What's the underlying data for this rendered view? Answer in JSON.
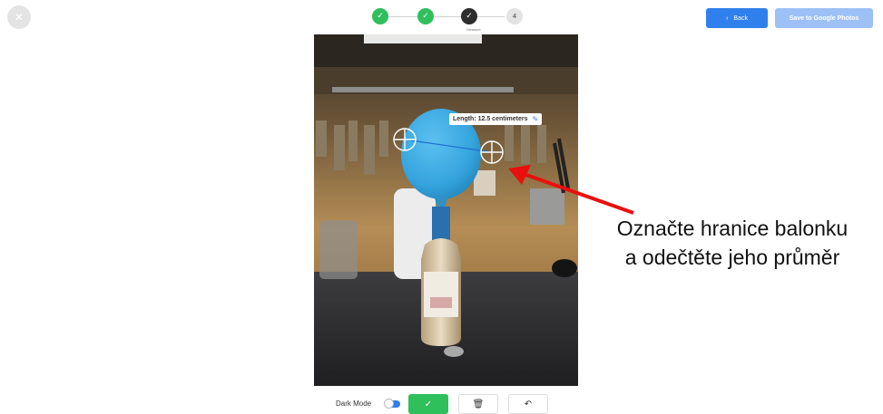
{
  "header": {
    "close_icon": "close-icon",
    "back_label": "Back",
    "back_icon": "chevron-left-icon",
    "save_label": "Save to Google Photos"
  },
  "stepper": {
    "steps": [
      {
        "state": "done",
        "glyph": "✓"
      },
      {
        "state": "done",
        "glyph": "✓"
      },
      {
        "state": "active",
        "glyph": "✓",
        "caption": "Measure"
      },
      {
        "state": "todo",
        "glyph": "4"
      }
    ]
  },
  "measurement": {
    "label": "Length: 12.5 centimeters",
    "edit_icon": "edit-icon"
  },
  "annotation": {
    "line1": "Označte hranice balonku",
    "line2": "a odečtěte jeho průměr",
    "arrow_color": "#e8100c"
  },
  "toolbar": {
    "dark_mode_label": "Dark Mode",
    "confirm_glyph": "✓",
    "delete_glyph": "🗑",
    "undo_glyph": "↶"
  },
  "colors": {
    "primary": "#2f80ed",
    "success": "#2fbf5b",
    "balloon": "#3aa7e0"
  }
}
